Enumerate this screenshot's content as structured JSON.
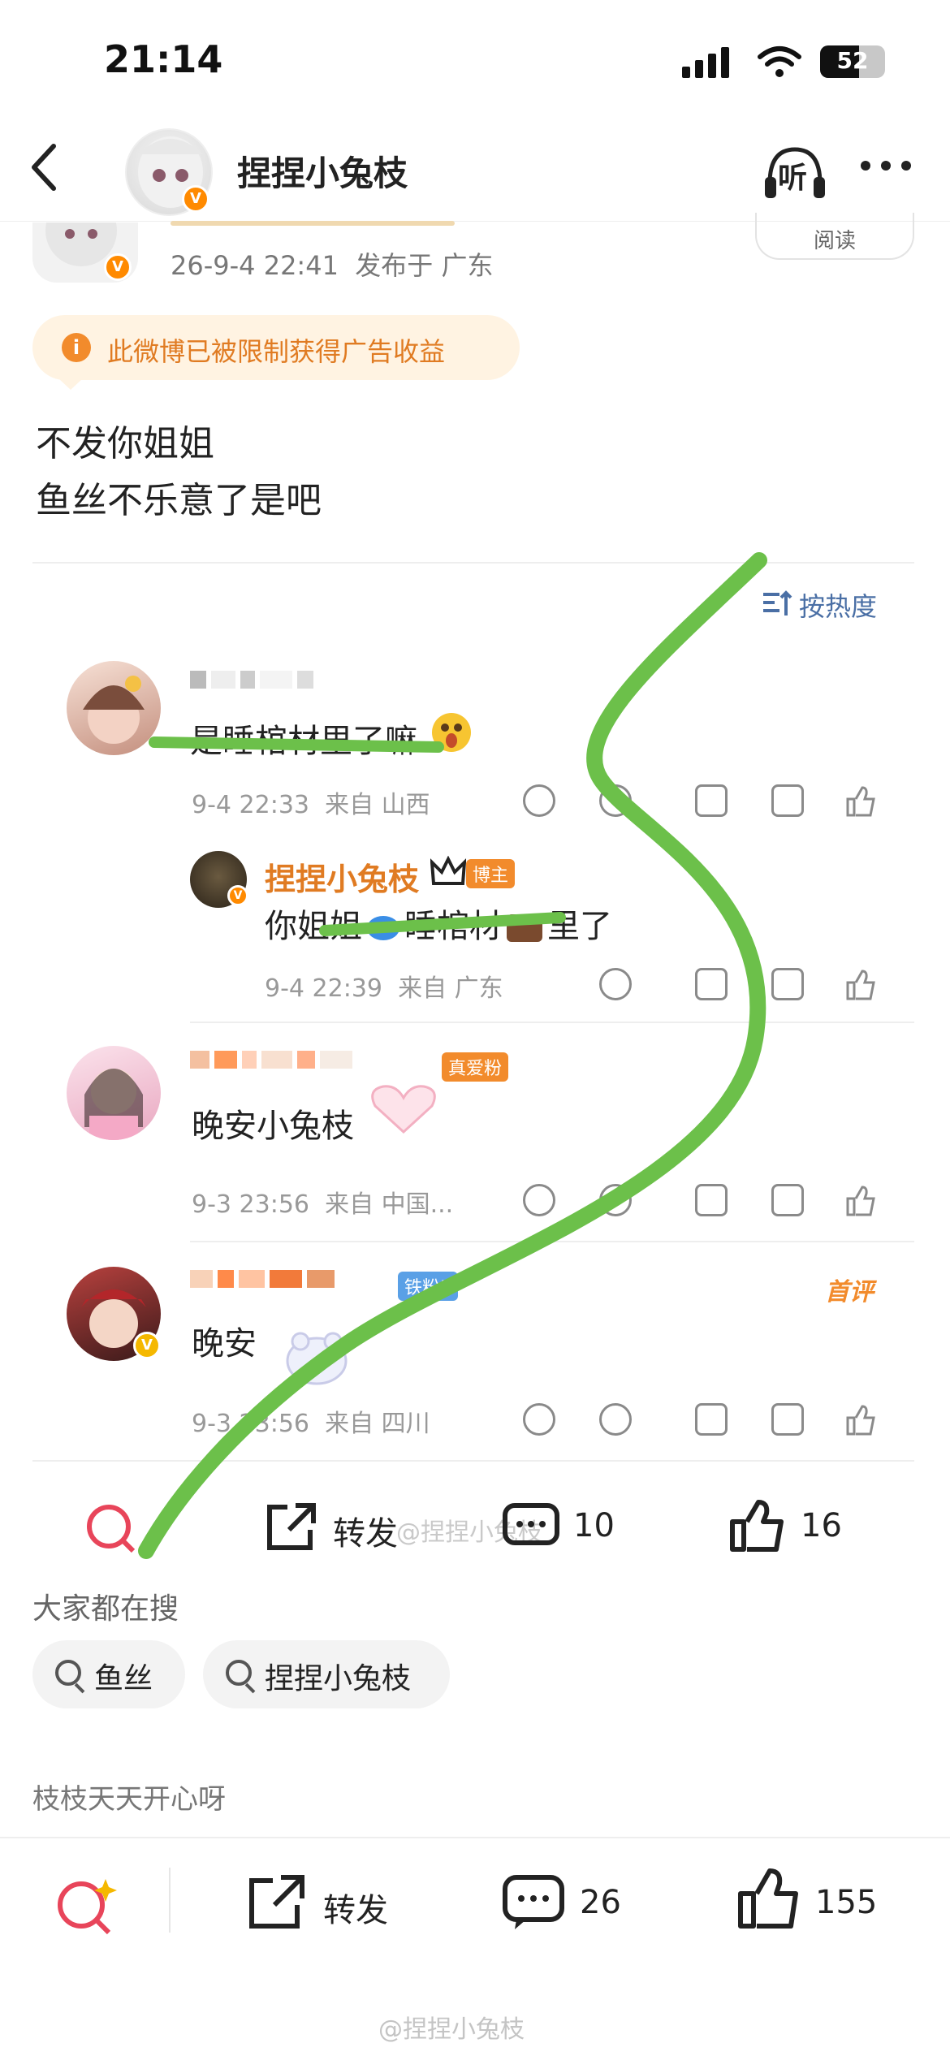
{
  "status_bar": {
    "time": "21:14",
    "battery": "52"
  },
  "header": {
    "author": "捏捏小兔枝",
    "listen": "听"
  },
  "post": {
    "date": "26-9-4 22:41",
    "location": "发布于 广东",
    "read_label": "阅读",
    "ad_notice": "此微博已被限制获得广告收益",
    "text_line1": "不发你姐姐",
    "text_line2": "鱼丝不乐意了是吧"
  },
  "comments_header": {
    "sort": "按热度"
  },
  "comments": [
    {
      "text": "是睡棺材里了嘛",
      "time": "9-4 22:33",
      "from": "来自 山西"
    },
    {
      "author": "捏捏小兔枝",
      "badge": "博主",
      "text_a": "你姐姐",
      "text_b": "睡棺材",
      "text_c": "里了",
      "time": "9-4 22:39",
      "from": "来自 广东"
    },
    {
      "badge": "真爱粉",
      "text": "晚安小兔枝",
      "time": "9-3 23:56",
      "from": "来自 中国..."
    },
    {
      "badge": "铁粉5",
      "tag": "首评",
      "text": "晚安",
      "time": "9-3 23:56",
      "from": "来自 四川"
    }
  ],
  "inner_toolbar": {
    "repost": "转发",
    "comments": "10",
    "likes": "16",
    "watermark": "@捏捏小兔枝"
  },
  "search_section": {
    "title": "大家都在搜",
    "chips": [
      "鱼丝",
      "捏捏小兔枝"
    ]
  },
  "next_post_preview": "枝枝天天开心呀",
  "bottom_toolbar": {
    "repost": "转发",
    "comments": "26",
    "likes": "155"
  },
  "footer_watermark": "@捏捏小兔枝",
  "colors": {
    "accent_orange": "#f28b2c",
    "link_blue": "#4a6fa5",
    "annotation_green": "#6cc04a"
  }
}
